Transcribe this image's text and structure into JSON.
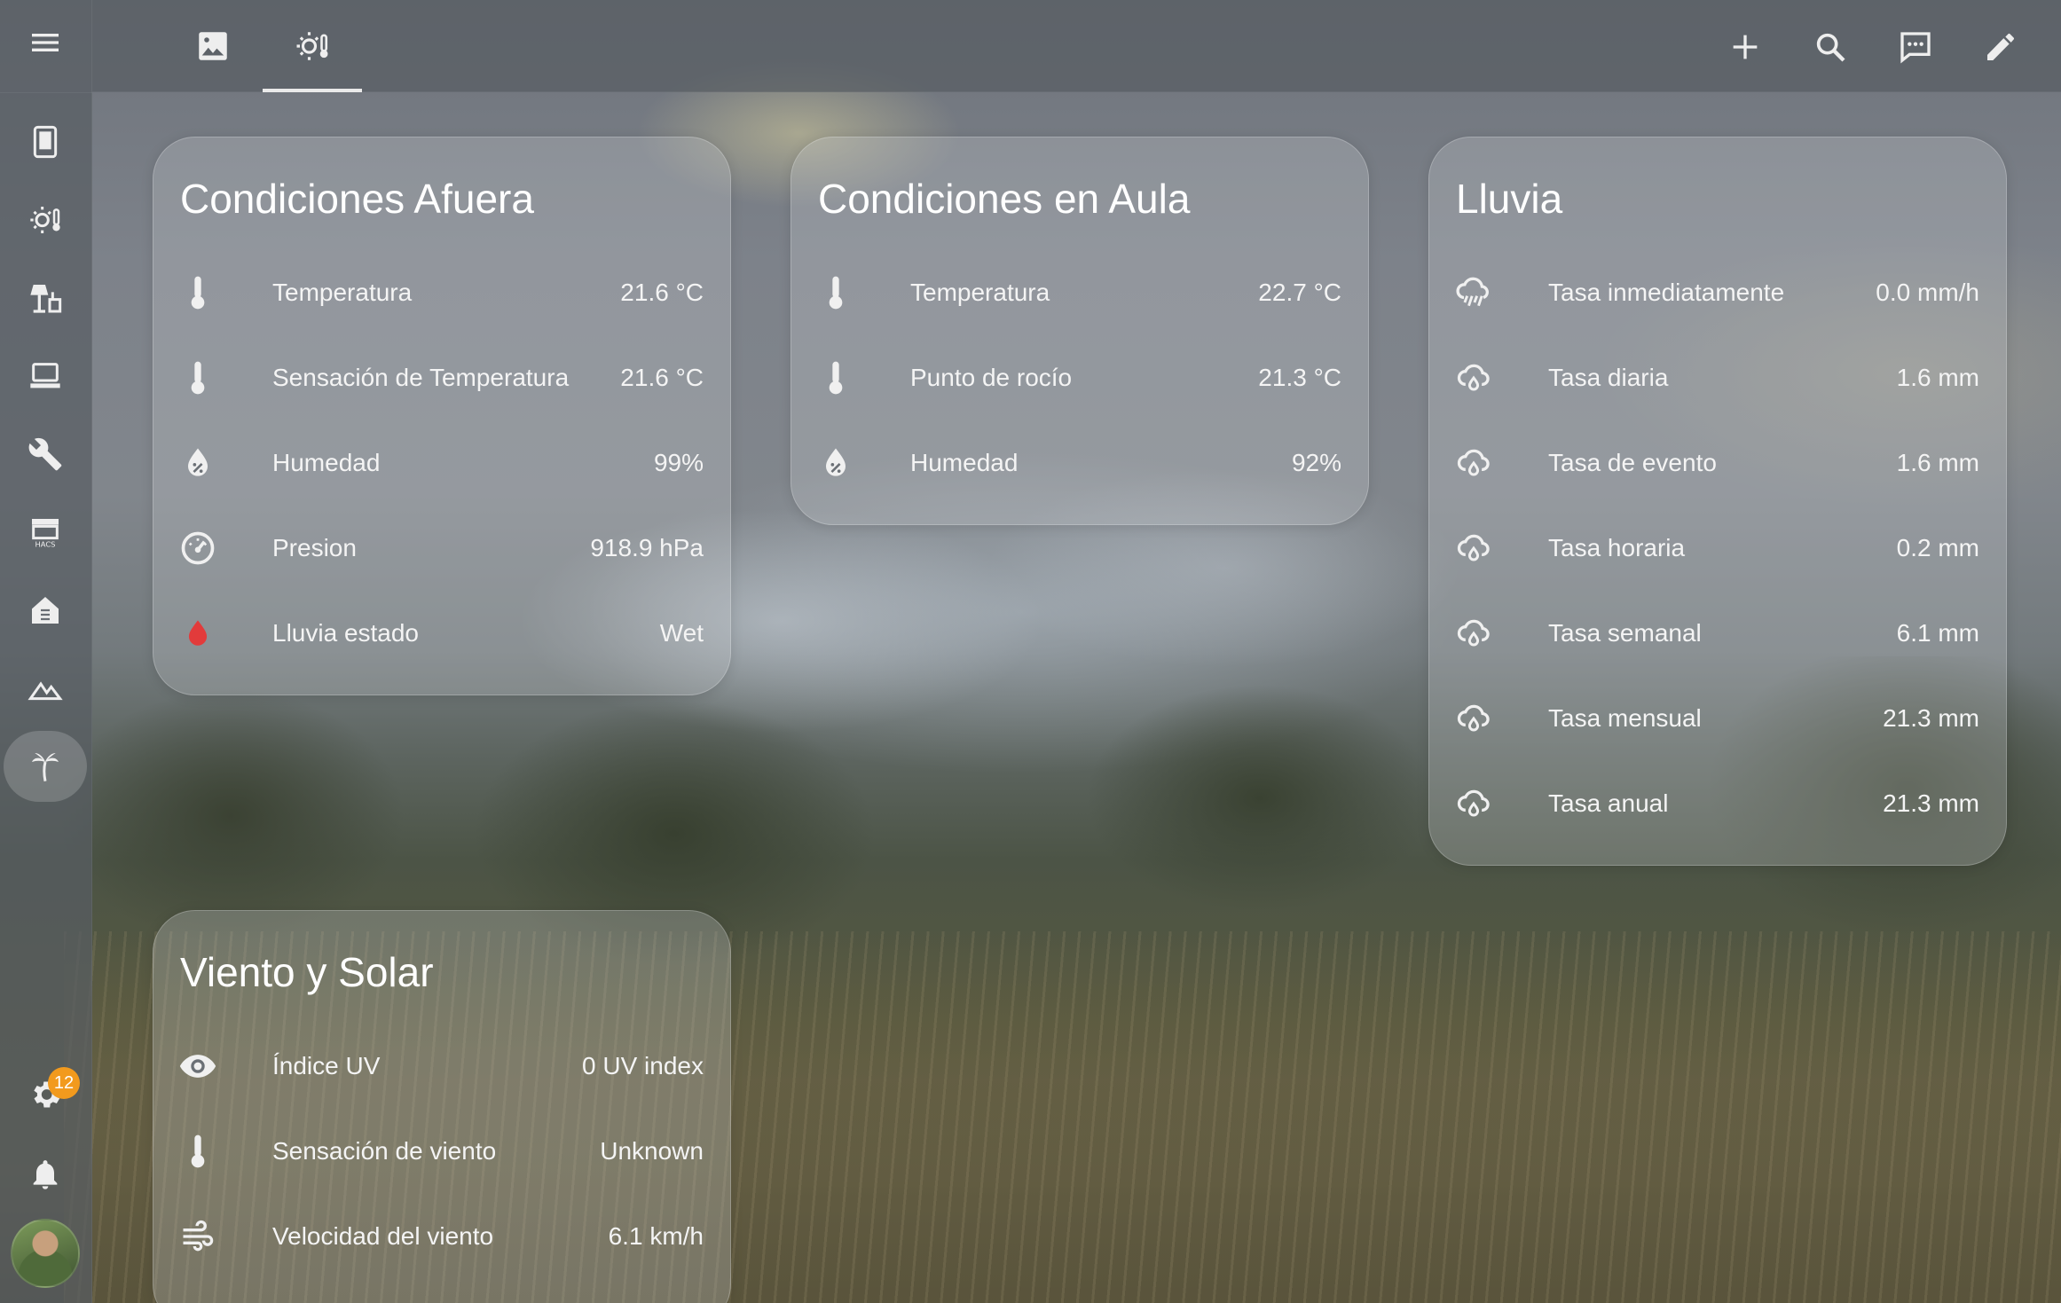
{
  "colors": {
    "accent": "#eaeaea",
    "badge": "#f29a1d",
    "rain_drop": "#e23b3b",
    "icon": "#f0f0f0"
  },
  "sidebar": {
    "menu_icon": "menu-icon",
    "items": [
      {
        "name": "tablet",
        "icon": "tablet-icon",
        "active": false
      },
      {
        "name": "weather",
        "icon": "sun-thermometer-icon",
        "active": false
      },
      {
        "name": "lamp",
        "icon": "lamp-icon",
        "active": false
      },
      {
        "name": "devices",
        "icon": "laptop-icon",
        "active": false
      },
      {
        "name": "tools",
        "icon": "wrench-icon",
        "active": false
      },
      {
        "name": "hacs",
        "icon": "hacs-store-icon",
        "active": false
      },
      {
        "name": "home-assistant",
        "icon": "home-icon",
        "active": false
      },
      {
        "name": "mountains",
        "icon": "mountain-icon",
        "active": false
      },
      {
        "name": "palm",
        "icon": "palm-tree-icon",
        "active": true
      }
    ],
    "settings_badge": "12"
  },
  "topbar": {
    "tabs": [
      {
        "icon": "image-icon",
        "active": false
      },
      {
        "icon": "sun-thermometer-icon",
        "active": true
      }
    ],
    "actions": [
      "add-icon",
      "search-icon",
      "assist-icon",
      "edit-icon"
    ]
  },
  "cards": {
    "afuera": {
      "title": "Condiciones Afuera",
      "rows": [
        {
          "icon": "thermometer-icon",
          "label": "Temperatura",
          "value": "21.6 °C"
        },
        {
          "icon": "thermometer-icon",
          "label": "Sensación de Temperatura",
          "value": "21.6 °C"
        },
        {
          "icon": "water-percent-icon",
          "label": "Humedad",
          "value": "99%"
        },
        {
          "icon": "gauge-icon",
          "label": "Presion",
          "value": "918.9 hPa"
        },
        {
          "icon": "water-drop-icon",
          "label": "Lluvia estado",
          "value": "Wet"
        }
      ]
    },
    "aula": {
      "title": "Condiciones en Aula",
      "rows": [
        {
          "icon": "thermometer-icon",
          "label": "Temperatura",
          "value": "22.7 °C"
        },
        {
          "icon": "thermometer-icon",
          "label": "Punto de rocío",
          "value": "21.3 °C"
        },
        {
          "icon": "water-percent-icon",
          "label": "Humedad",
          "value": "92%"
        }
      ]
    },
    "lluvia": {
      "title": "Lluvia",
      "rows": [
        {
          "icon": "weather-pouring-icon",
          "label": "Tasa inmediatamente",
          "value": "0.0 mm/h"
        },
        {
          "icon": "cloud-rain-drop-icon",
          "label": "Tasa diaria",
          "value": "1.6 mm"
        },
        {
          "icon": "cloud-rain-drop-icon",
          "label": "Tasa de evento",
          "value": "1.6 mm"
        },
        {
          "icon": "cloud-rain-drop-icon",
          "label": "Tasa horaria",
          "value": "0.2 mm"
        },
        {
          "icon": "cloud-rain-drop-icon",
          "label": "Tasa semanal",
          "value": "6.1 mm"
        },
        {
          "icon": "cloud-rain-drop-icon",
          "label": "Tasa mensual",
          "value": "21.3 mm"
        },
        {
          "icon": "cloud-rain-drop-icon",
          "label": "Tasa anual",
          "value": "21.3 mm"
        }
      ]
    },
    "viento": {
      "title": "Viento y Solar",
      "rows": [
        {
          "icon": "eye-icon",
          "label": "Índice UV",
          "value": "0 UV index"
        },
        {
          "icon": "thermometer-icon",
          "label": "Sensación de viento",
          "value": "Unknown"
        },
        {
          "icon": "weather-windy-icon",
          "label": "Velocidad del viento",
          "value": "6.1 km/h"
        }
      ]
    }
  }
}
